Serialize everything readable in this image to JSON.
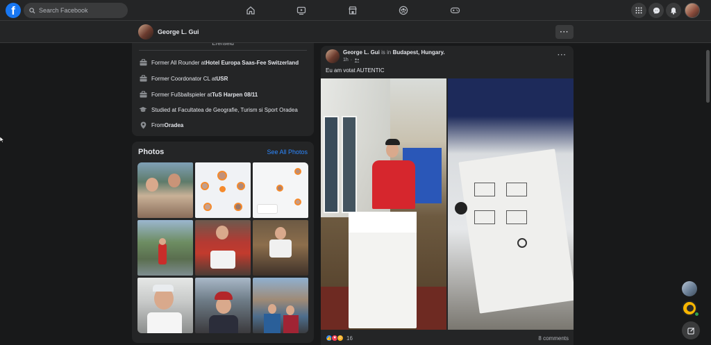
{
  "search": {
    "placeholder": "Search Facebook"
  },
  "logo": {
    "letter": "f"
  },
  "profile": {
    "name": "George L. Gui"
  },
  "intro": {
    "cut_top_text": "Erenseid",
    "items": [
      {
        "icon": "briefcase-icon",
        "prefix": "Former All Rounder at ",
        "bold": "Hotel Europa Saas-Fee Switzerland"
      },
      {
        "icon": "briefcase-icon",
        "prefix": "Former Coordonator CL at ",
        "bold": "USR"
      },
      {
        "icon": "briefcase-icon",
        "prefix": "Former Fußballspieler at ",
        "bold": "TuS Harpen 08/11"
      },
      {
        "icon": "graduation-cap-icon",
        "prefix": "Studied at Facultatea de Geografie, Turism si Sport Oradea",
        "bold": ""
      },
      {
        "icon": "location-pin-icon",
        "prefix": "From ",
        "bold": "Oradea"
      }
    ]
  },
  "photos": {
    "title": "Photos",
    "see_all": "See All Photos"
  },
  "post": {
    "author": "George L. Gui",
    "is_in": " is in ",
    "place": "Budapest, Hungary.",
    "time": "1h",
    "text": "Eu am votat AUTENTIC",
    "reaction_count": "16",
    "comments": "8 comments"
  },
  "colors": {
    "accent": "#1877f2",
    "link": "#2d88ff",
    "card": "#242526",
    "background": "#18191a"
  }
}
